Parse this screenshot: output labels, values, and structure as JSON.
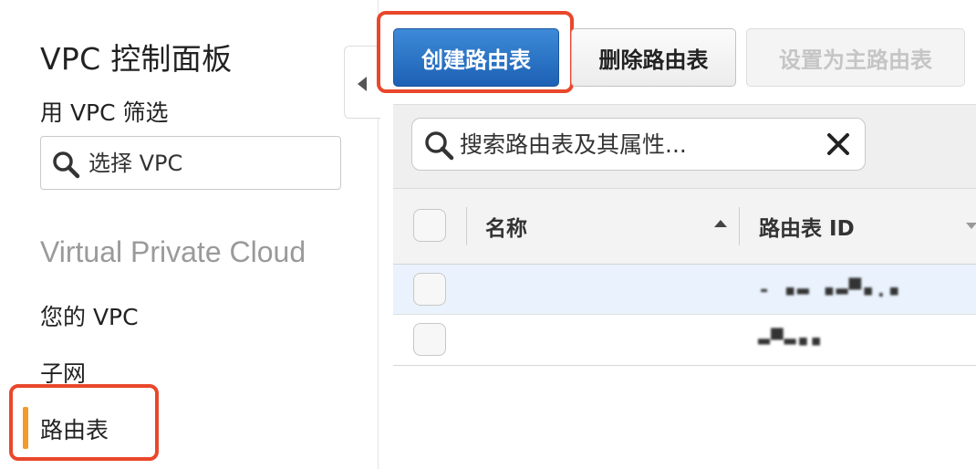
{
  "sidebar": {
    "title": "VPC 控制面板",
    "filter_label": "用 VPC 筛选",
    "vpc_select_placeholder": "选择 VPC",
    "section_title": "Virtual Private Cloud",
    "items": [
      {
        "label": "您的 VPC"
      },
      {
        "label": "子网"
      },
      {
        "label": "路由表",
        "active": true
      }
    ]
  },
  "toolbar": {
    "create_label": "创建路由表",
    "delete_label": "删除路由表",
    "set_main_label": "设置为主路由表"
  },
  "table": {
    "search_placeholder": "搜索路由表及其属性...",
    "columns": [
      "名称",
      "路由表 ID"
    ],
    "rows": [
      {
        "name": "",
        "id": "‑ ▪▬ ▪▬▀▪.▪"
      },
      {
        "name": "",
        "id": "▬▀▬▪▪"
      }
    ]
  },
  "colors": {
    "primary_button": "#2a74c8",
    "highlight": "#e9472b",
    "active_indicator": "#f39a2a"
  },
  "icons": {
    "search": "magnifier-icon",
    "clear": "x-icon",
    "collapse": "triangle-left-icon"
  }
}
